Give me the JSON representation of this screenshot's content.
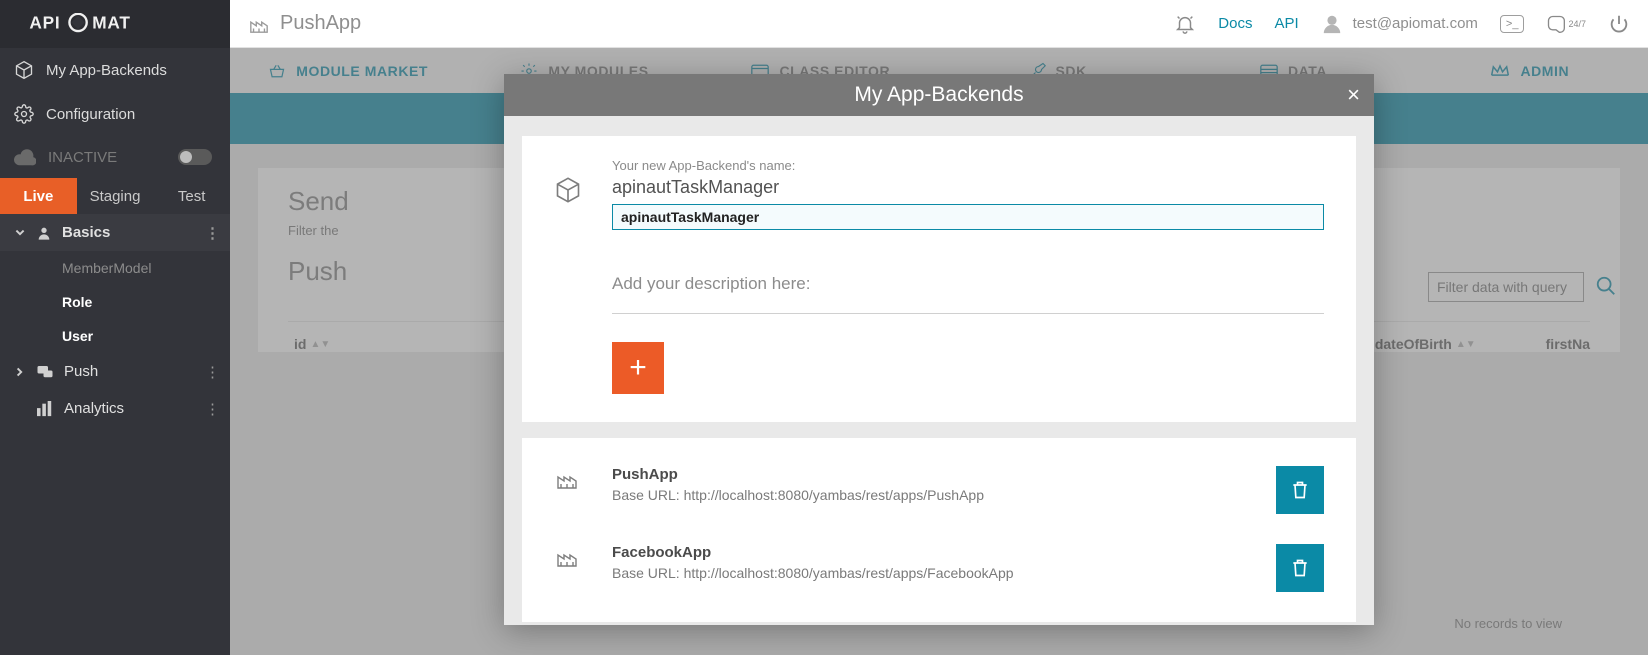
{
  "logo_text": "APIOMAT",
  "header": {
    "app_name": "PushApp",
    "docs": "Docs",
    "api": "API",
    "user_email": "test@apiomat.com",
    "support_badge": "24/7"
  },
  "sidebar": {
    "my_backends": "My App-Backends",
    "configuration": "Configuration",
    "inactive": "INACTIVE",
    "env": {
      "live": "Live",
      "staging": "Staging",
      "test": "Test"
    },
    "basics": "Basics",
    "member_model": "MemberModel",
    "role": "Role",
    "user": "User",
    "push": "Push",
    "analytics": "Analytics"
  },
  "navtabs": {
    "market": "MODULE MARKET",
    "modules": "MY MODULES",
    "class_editor": "CLASS EDITOR",
    "sdk": "SDK",
    "data": "DATA",
    "admin": "ADMIN"
  },
  "content": {
    "send_title": "Send",
    "filter_hint": "Filter the",
    "push_title": "Push",
    "filter_placeholder": "Filter data with query",
    "col_id": "id",
    "col_dob": "dateOfBirth",
    "col_firstn": "firstNa",
    "no_records": "No records to view"
  },
  "modal": {
    "title": "My App-Backends",
    "new_name_label": "Your new App-Backend's name:",
    "name_value": "apinautTaskManager",
    "name_input_value": "apinautTaskManager",
    "desc_label": "Add your description here:",
    "apps": [
      {
        "name": "PushApp",
        "url": "Base URL: http://localhost:8080/yambas/rest/apps/PushApp"
      },
      {
        "name": "FacebookApp",
        "url": "Base URL: http://localhost:8080/yambas/rest/apps/FacebookApp"
      }
    ]
  }
}
